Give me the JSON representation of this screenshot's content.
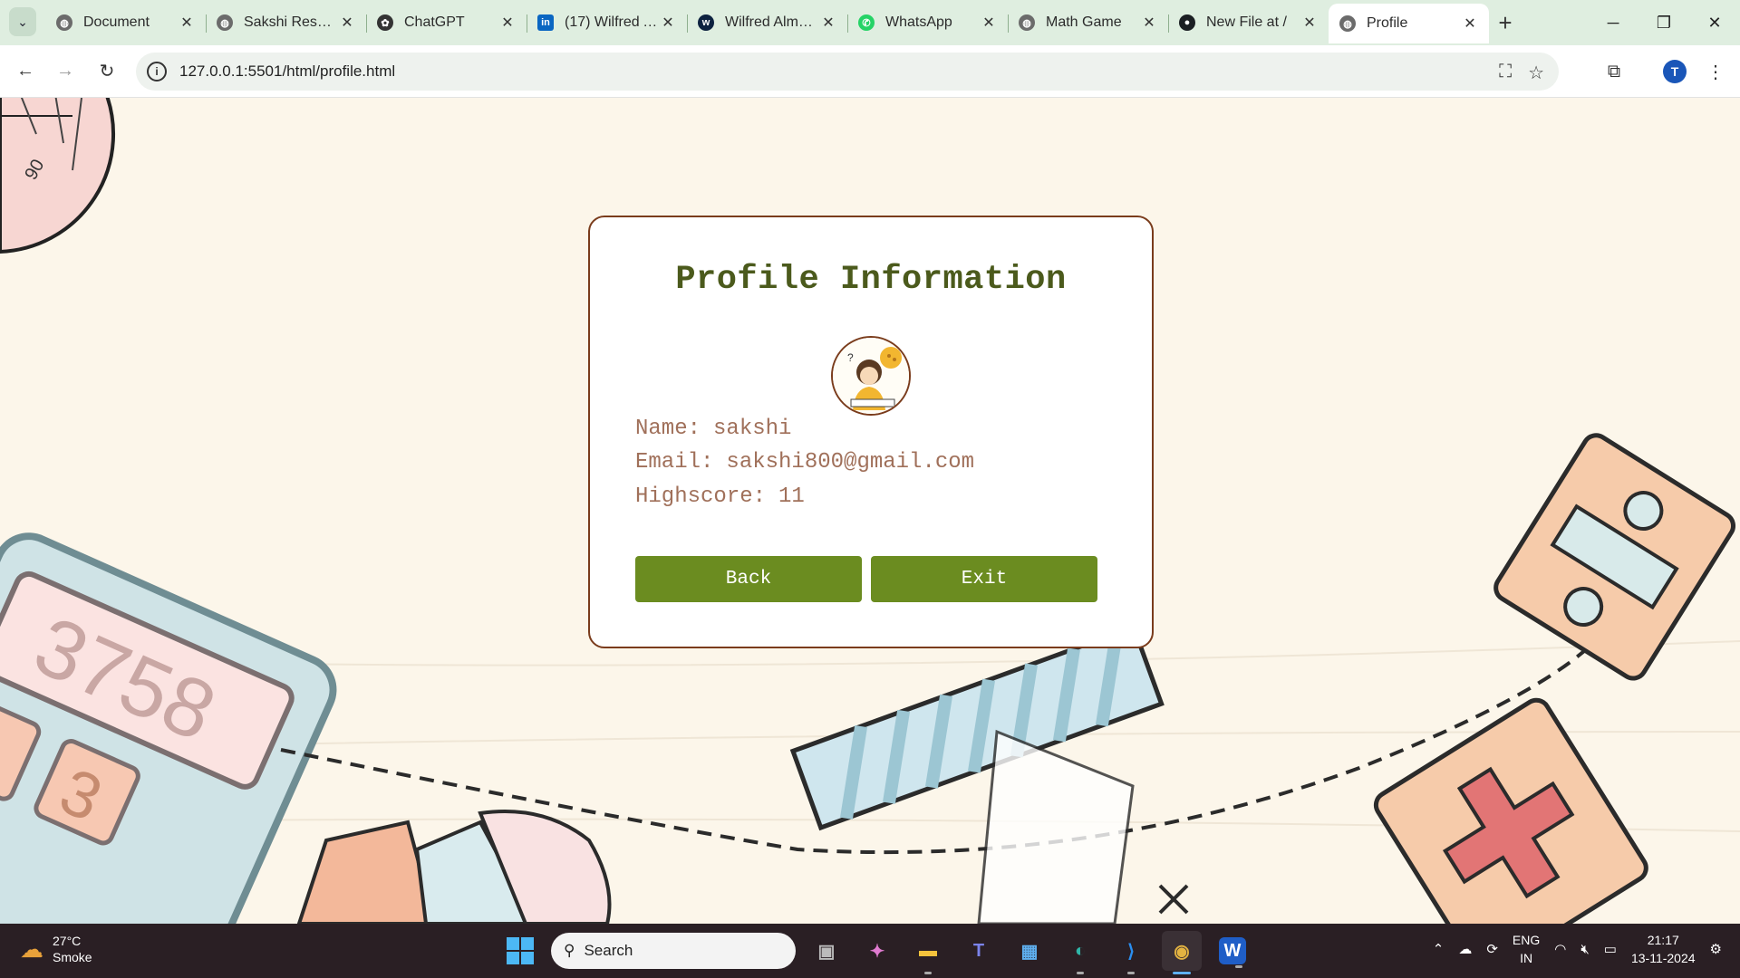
{
  "browser": {
    "tabs": [
      {
        "label": "Document",
        "icon": "globe-icon"
      },
      {
        "label": "Sakshi Resume",
        "icon": "globe-icon"
      },
      {
        "label": "ChatGPT",
        "icon": "openai-icon"
      },
      {
        "label": "(17) Wilfred Almeida",
        "icon": "linkedin-icon"
      },
      {
        "label": "Wilfred Almeida",
        "icon": "w-icon"
      },
      {
        "label": "WhatsApp",
        "icon": "whatsapp-icon"
      },
      {
        "label": "Math Game",
        "icon": "globe-icon"
      },
      {
        "label": "New File at /",
        "icon": "github-icon"
      },
      {
        "label": "Profile",
        "icon": "globe-icon",
        "active": true
      }
    ],
    "url": "127.0.0.1:5501/html/profile.html",
    "avatar_letter": "T"
  },
  "profile": {
    "title": "Profile Information",
    "name_label": "Name:",
    "name_value": "sakshi",
    "email_label": "Email:",
    "email_value": "sakshi800@gmail.com",
    "highscore_label": "Highscore:",
    "highscore_value": "11",
    "back_label": "Back",
    "exit_label": "Exit"
  },
  "background": {
    "protractor_text": "90",
    "calculator_display": "3758",
    "calculator_key": "3"
  },
  "taskbar": {
    "temperature": "27°C",
    "condition": "Smoke",
    "search_placeholder": "Search",
    "lang_top": "ENG",
    "lang_bottom": "IN",
    "time": "21:17",
    "date": "13-11-2024"
  },
  "colors": {
    "accent_green": "#6b8c20",
    "title_olive": "#4b5a1c",
    "card_border": "#7a3c1c",
    "info_text": "#a0705a"
  }
}
